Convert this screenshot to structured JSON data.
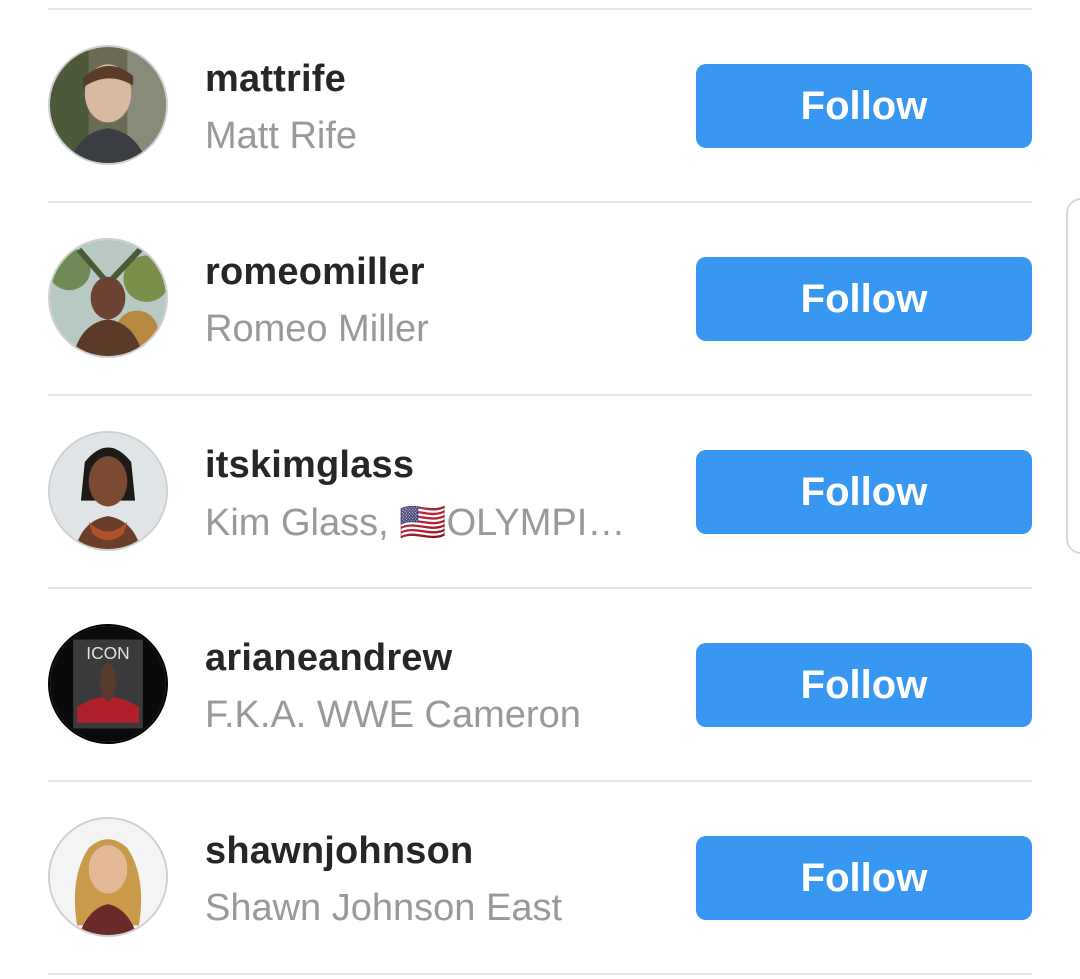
{
  "suggestions": [
    {
      "username": "mattrife",
      "full_name": "Matt Rife",
      "button": "Follow"
    },
    {
      "username": "romeomiller",
      "full_name": "Romeo Miller",
      "button": "Follow"
    },
    {
      "username": "itskimglass",
      "full_name": "Kim Glass, 🇺🇸OLYMPI…",
      "button": "Follow"
    },
    {
      "username": "arianeandrew",
      "full_name": "F.K.A. WWE Cameron",
      "button": "Follow",
      "avatar_text": "ICON"
    },
    {
      "username": "shawnjohnson",
      "full_name": "Shawn Johnson East",
      "button": "Follow"
    }
  ],
  "colors": {
    "button_bg": "#3897f0",
    "button_text": "#ffffff",
    "username": "#262626",
    "full_name": "#999999",
    "divider": "#e6e6e6"
  }
}
